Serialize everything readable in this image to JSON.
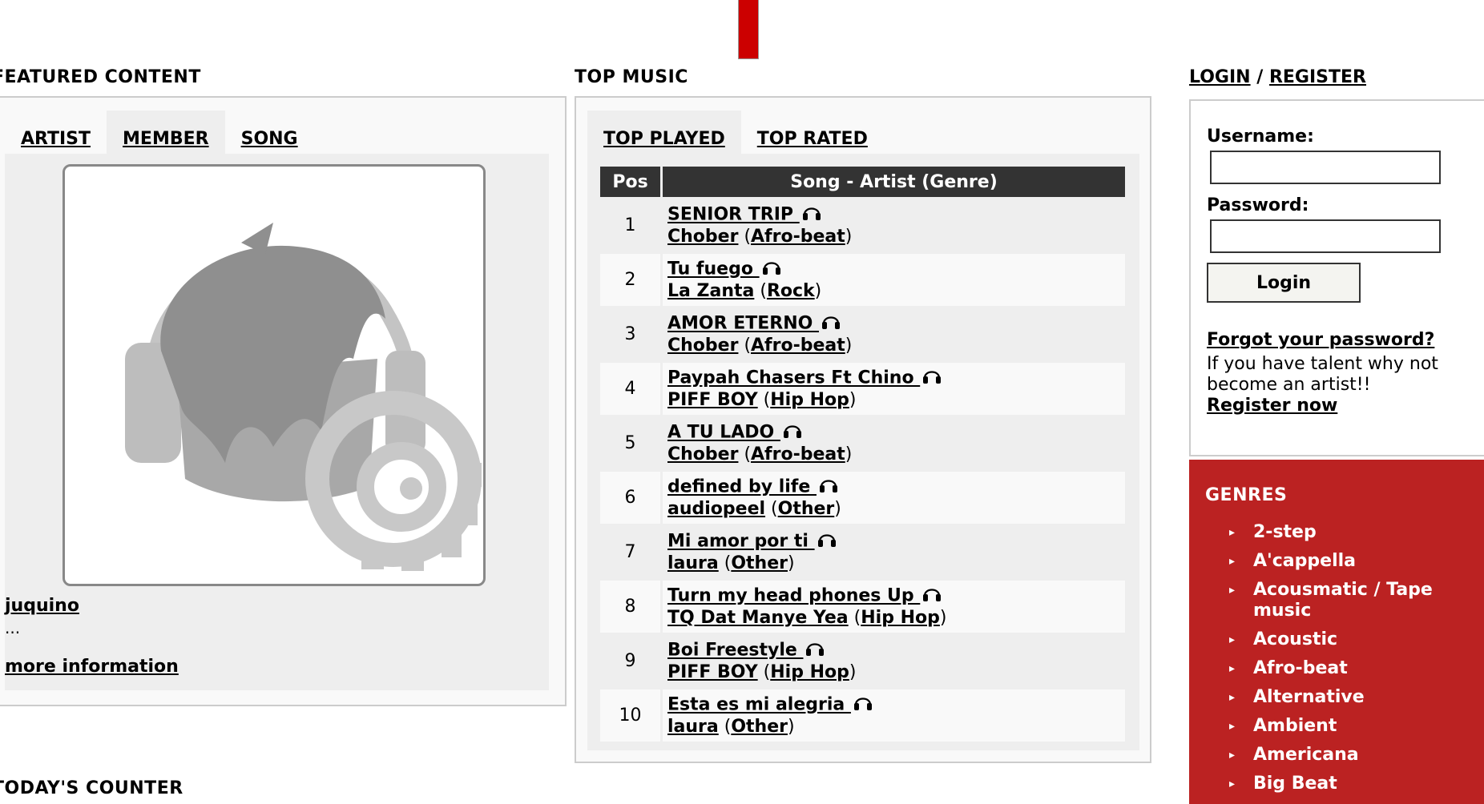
{
  "featured": {
    "title": "FEATURED CONTENT",
    "tabs": [
      {
        "label": "ARTIST"
      },
      {
        "label": "MEMBER"
      },
      {
        "label": "SONG"
      }
    ],
    "member": {
      "name": "juquino",
      "description": "...",
      "more_info": "more information"
    }
  },
  "top_music": {
    "title": "TOP MUSIC",
    "tabs": [
      {
        "label": "TOP PLAYED"
      },
      {
        "label": "TOP RATED"
      }
    ],
    "headers": {
      "pos": "Pos",
      "song": "Song - Artist (Genre)"
    },
    "rows": [
      {
        "pos": "1",
        "song": "SENIOR TRIP ",
        "artist": "Chober",
        "genre": "Afro-beat"
      },
      {
        "pos": "2",
        "song": "Tu fuego ",
        "artist": "La Zanta",
        "genre": "Rock"
      },
      {
        "pos": "3",
        "song": "AMOR ETERNO ",
        "artist": "Chober",
        "genre": "Afro-beat"
      },
      {
        "pos": "4",
        "song": "Paypah Chasers Ft Chino ",
        "artist": "PIFF BOY",
        "genre": "Hip Hop"
      },
      {
        "pos": "5",
        "song": "A TU LADO ",
        "artist": "Chober",
        "genre": "Afro-beat"
      },
      {
        "pos": "6",
        "song": "defined by life ",
        "artist": "audiopeel",
        "genre": "Other"
      },
      {
        "pos": "7",
        "song": "Mi amor por ti ",
        "artist": "laura",
        "genre": "Other"
      },
      {
        "pos": "8",
        "song": "Turn my head phones Up ",
        "artist": "TQ Dat Manye Yea",
        "genre": "Hip Hop"
      },
      {
        "pos": "9",
        "song": "Boi Freestyle ",
        "artist": "PIFF BOY",
        "genre": "Hip Hop"
      },
      {
        "pos": "10",
        "song": "Esta es mi alegria ",
        "artist": "laura",
        "genre": "Other"
      }
    ]
  },
  "login": {
    "login_link": "LOGIN",
    "separator": " / ",
    "register_link": "REGISTER",
    "username_label": "Username:",
    "username_value": "",
    "password_label": "Password:",
    "password_value": "",
    "button": "Login",
    "forgot": "Forgot your password?",
    "talent_text": "If you have talent why not become an artist!!",
    "register_now": "Register now"
  },
  "genres": {
    "title": "GENRES",
    "items": [
      "2-step",
      "A'cappella",
      "Acousmatic / Tape music",
      "Acoustic",
      "Afro-beat",
      "Alternative",
      "Ambient",
      "Americana",
      "Big Beat"
    ]
  },
  "today_counter": "TODAY'S COUNTER",
  "colors": {
    "accent_red": "#cc0000",
    "genres_bg": "#bb2222",
    "table_header": "#333333"
  }
}
